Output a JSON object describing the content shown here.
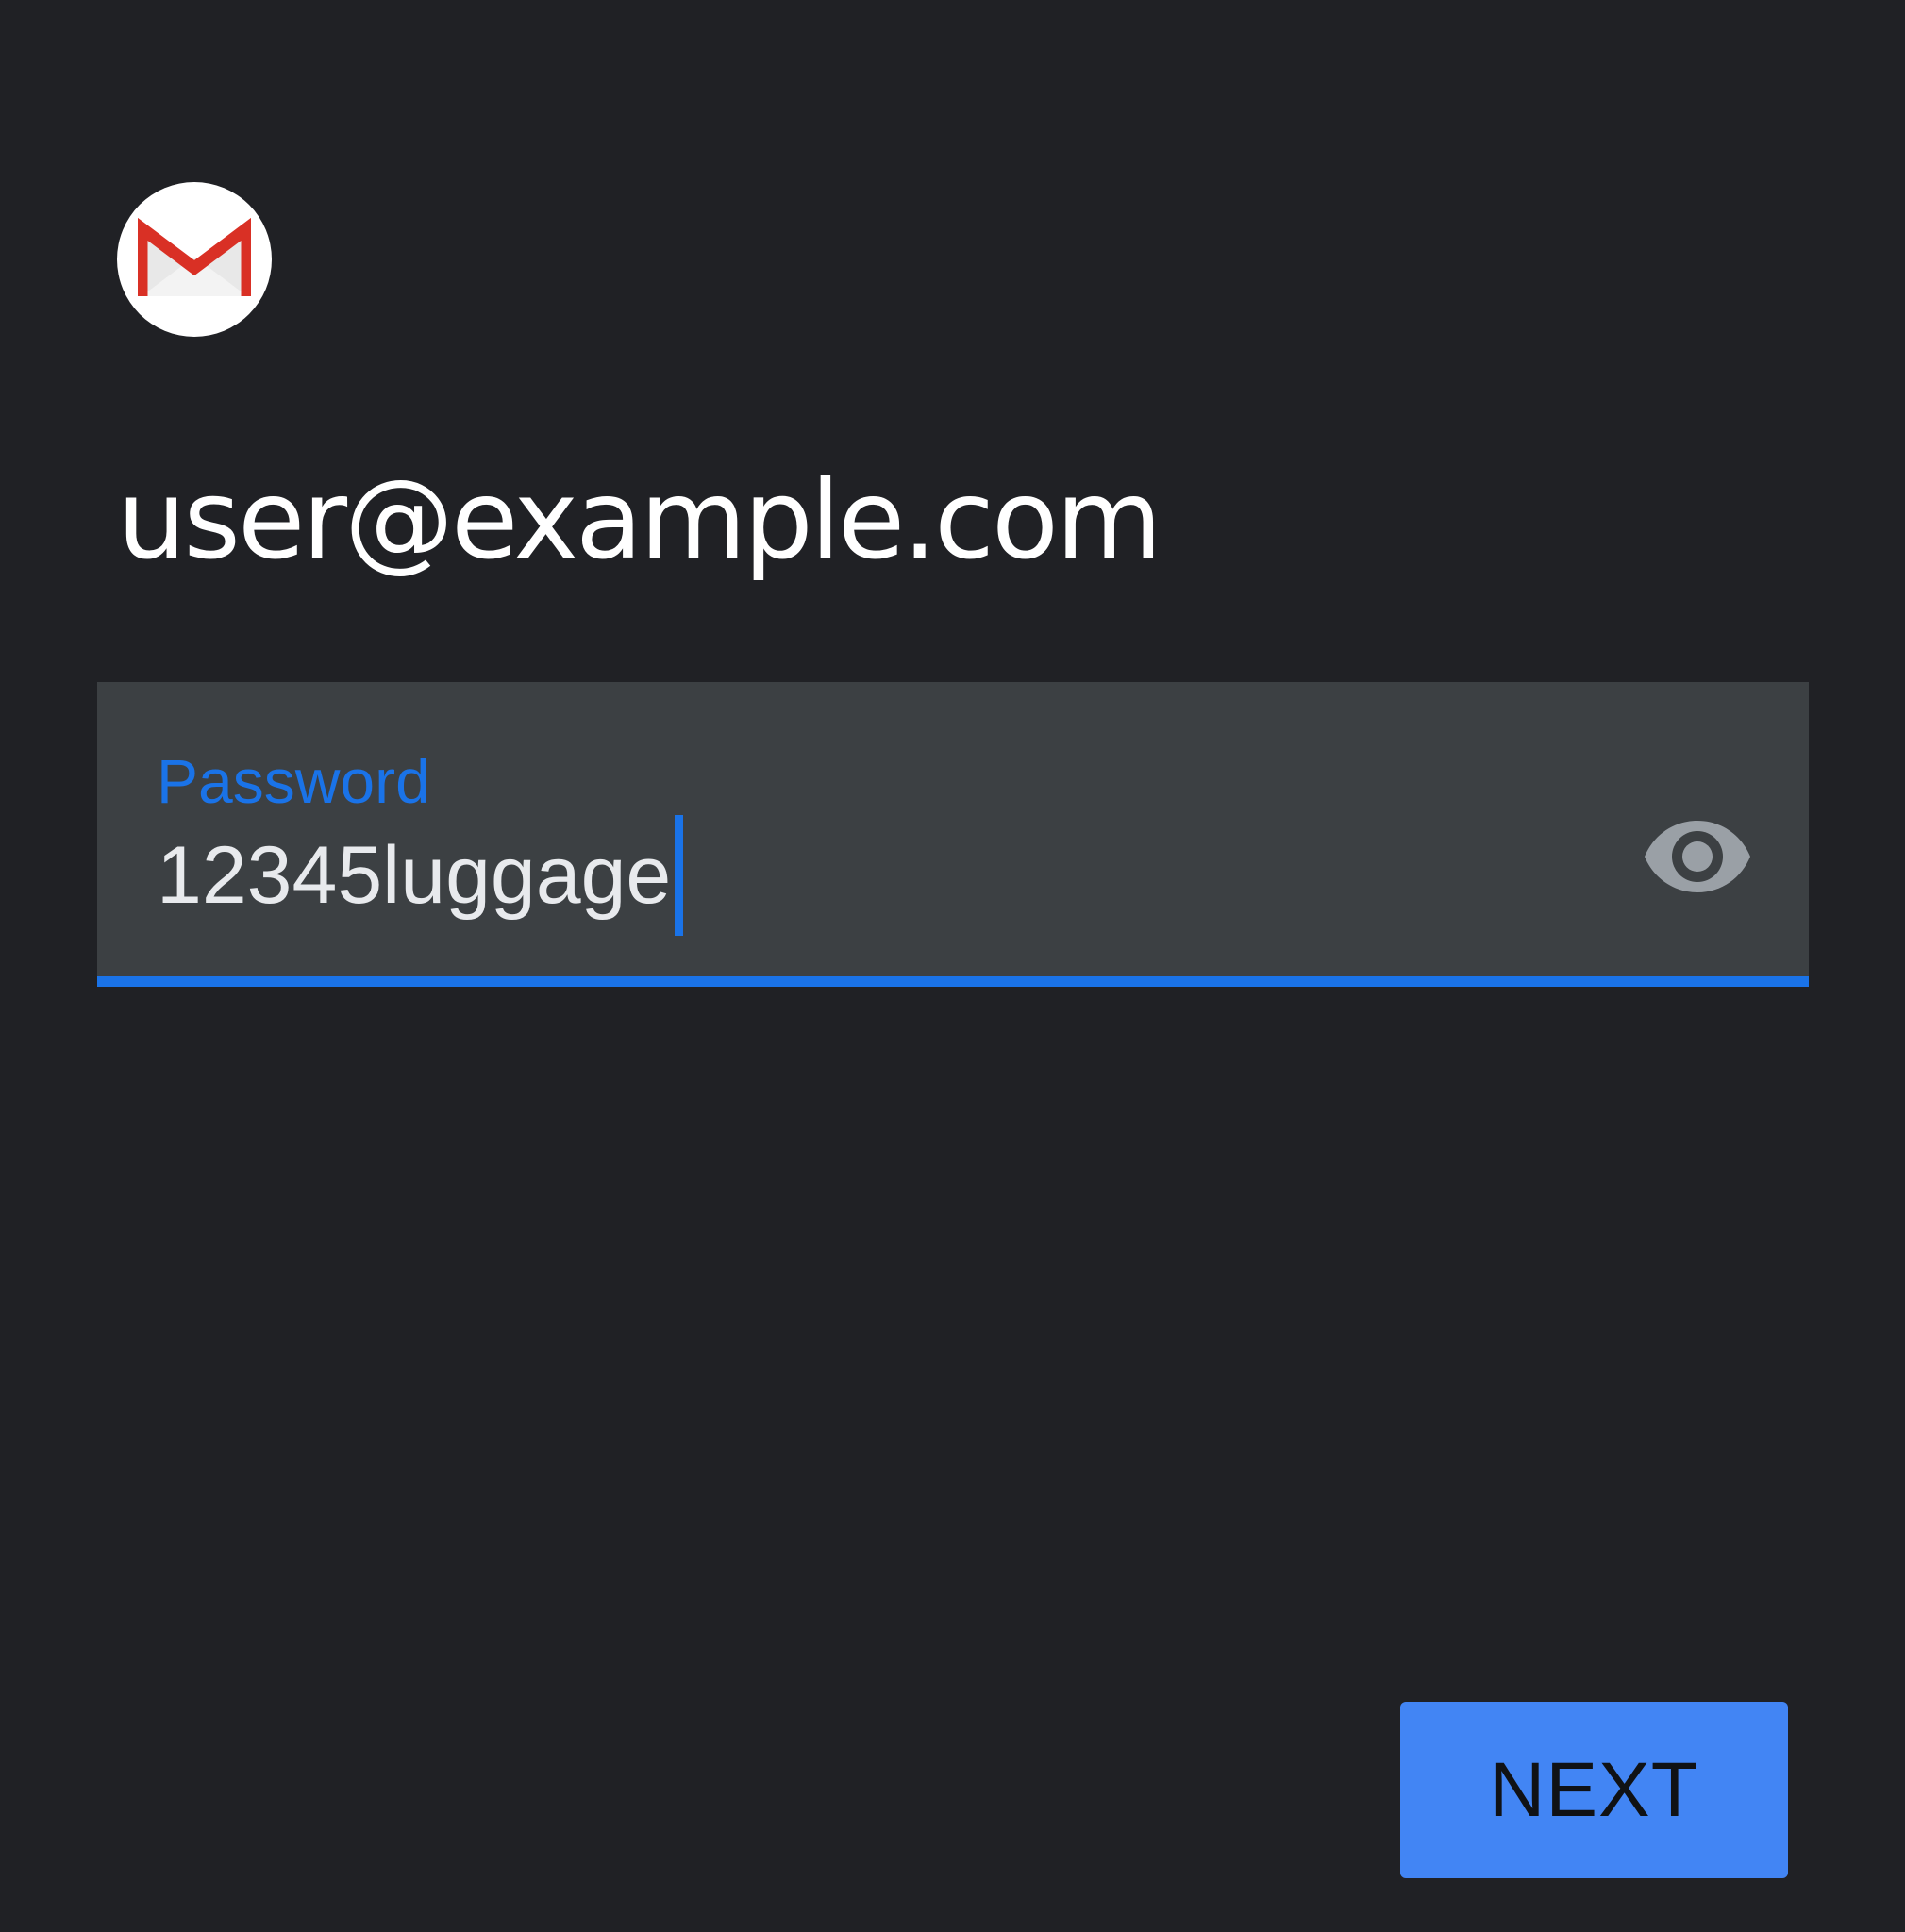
{
  "app": {
    "logo_icon": "gmail-icon"
  },
  "account": {
    "email": "user@example.com"
  },
  "password_field": {
    "label": "Password",
    "value": "12345luggage",
    "toggle_icon": "eye-icon"
  },
  "actions": {
    "next_label": "NEXT"
  },
  "colors": {
    "background": "#202125",
    "field_background": "#3c4043",
    "accent": "#1a73e8",
    "button": "#4285f4",
    "gmail_red": "#d93025"
  }
}
